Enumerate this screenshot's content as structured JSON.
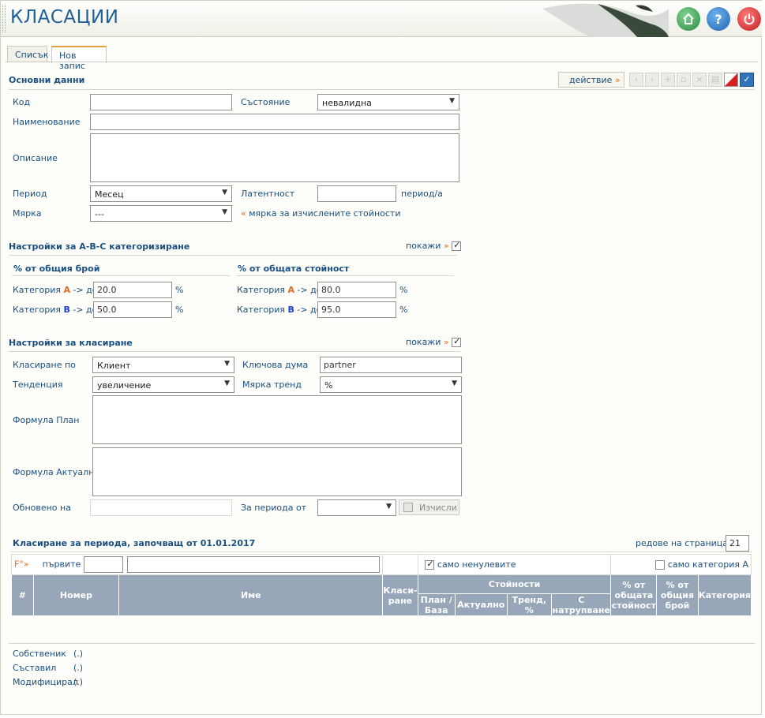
{
  "header": {
    "title": "КЛАСАЦИИ",
    "icons": [
      "home-icon",
      "help-icon",
      "power-icon"
    ]
  },
  "tabs": [
    {
      "label": "Списък"
    },
    {
      "label": "Нов запис"
    }
  ],
  "basic": {
    "section_title": "Основни данни",
    "action_label": "действие",
    "code_label": "Код",
    "code_value": "",
    "state_label": "Състояние",
    "state_value": "невалидна",
    "name_label": "Наименование",
    "name_value": "",
    "desc_label": "Описание",
    "desc_value": "",
    "period_label": "Период",
    "period_value": "Месец",
    "latency_label": "Латентност",
    "latency_value": "",
    "latency_unit": "период/а",
    "measure_label": "Мярка",
    "measure_value": "---",
    "measure_note": "мярка за изчислените стойности"
  },
  "abc": {
    "section_title": "Настройки за А-В-С категоризиране",
    "show_label": "покажи",
    "count_title": "% от общия брой",
    "value_title": "% от общата стойност",
    "cat_prefix": "Категория",
    "cat_suffix": "-> до",
    "percent": "%",
    "letter_a": "A",
    "letter_b": "B",
    "count_a": "20.0",
    "count_b": "50.0",
    "value_a": "80.0",
    "value_b": "95.0"
  },
  "ranking": {
    "section_title": "Настройки за класиране",
    "show_label": "покажи",
    "rank_by_label": "Класиране по",
    "rank_by_value": "Клиент",
    "keyword_label": "Ключова дума",
    "keyword_value": "partner",
    "trend_label": "Тенденция",
    "trend_value": "увеличение",
    "trend_measure_label": "Мярка тренд",
    "trend_measure_value": "%",
    "formula_plan_label": "Формула План",
    "formula_plan_value": "",
    "formula_actual_label": "Формула Актуално",
    "formula_actual_value": "",
    "updated_label": "Обновено на",
    "updated_value": "",
    "period_from_label": "За периода от",
    "period_from_value": "",
    "calc_label": "Изчисли"
  },
  "results": {
    "title": "Класиране за периода, започващ от 01.01.2017",
    "rows_label": "редове на страница",
    "rows_value": "21",
    "filter_icon": "F°»",
    "first_label": "първите",
    "first_value": "",
    "name_filter": "",
    "nonzero_label": "само ненулевите",
    "cat_a_label": "само категория А",
    "col_num": "#",
    "col_number": "Номер",
    "col_name": "Име",
    "col_rank": "Класи-ране",
    "col_values": "Стойности",
    "col_plan": "План / База",
    "col_actual": "Актуално",
    "col_trend": "Тренд, %",
    "col_cumulative": "С натрупване",
    "col_total_value": "% от общата стойност",
    "col_total_count": "% от общия брой",
    "col_category": "Категория"
  },
  "footer": [
    {
      "label": "Собственик",
      "value": "(.)"
    },
    {
      "label": "Съставил",
      "value": "(.)"
    },
    {
      "label": "Модифицирал",
      "value": "(.)"
    }
  ],
  "colors": {
    "accent": "#1a4f80",
    "orange": "#e86a1a",
    "table_header": "#97a6b8"
  }
}
